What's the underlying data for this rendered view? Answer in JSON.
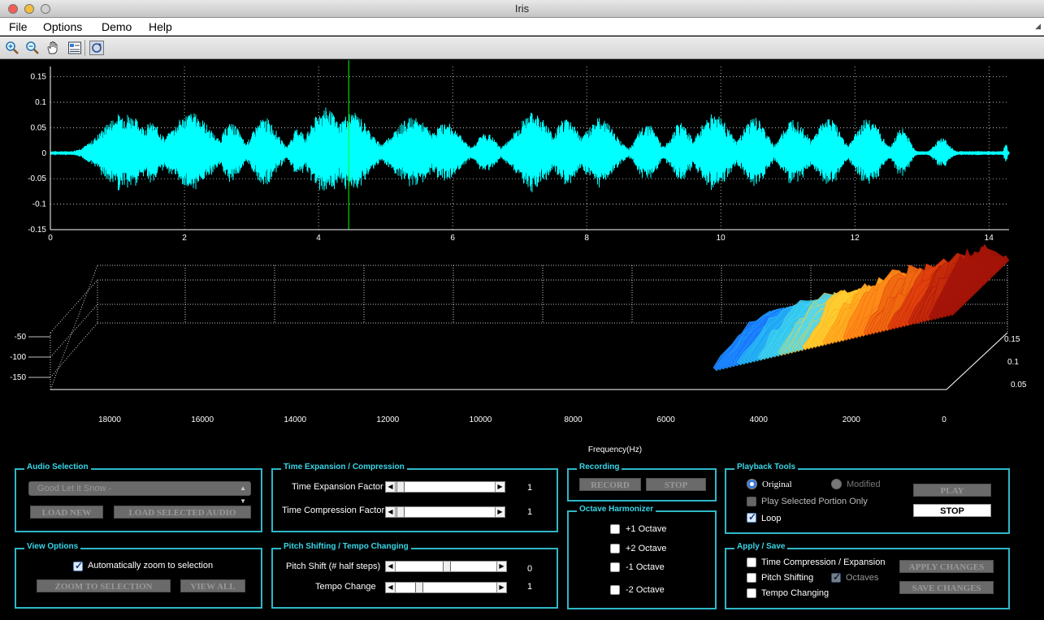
{
  "window": {
    "title": "Iris"
  },
  "menu": [
    {
      "label": "File"
    },
    {
      "label": "Options"
    },
    {
      "label": "Demo"
    },
    {
      "label": "Help"
    }
  ],
  "toolbar": [
    {
      "icon": "zoom-in-icon"
    },
    {
      "icon": "zoom-out-icon"
    },
    {
      "icon": "pan-hand-icon"
    },
    {
      "icon": "data-cursor-icon"
    },
    {
      "icon": "rotate-3d-icon"
    }
  ],
  "waveform": {
    "color": "#00ffff",
    "cursor_color": "#00ff00",
    "cursor_at": 4.45,
    "xlim": [
      0,
      14.3
    ],
    "ylim": [
      -0.15,
      0.17
    ],
    "x_ticks": [
      "0",
      "2",
      "4",
      "6",
      "8",
      "10",
      "12",
      "14"
    ],
    "y_ticks": [
      "0.15",
      "0.1",
      "0.05",
      "0",
      "-0.05",
      "-0.1",
      "-0.15"
    ]
  },
  "spectrogram": {
    "z_ticks": [
      "-50",
      "-100",
      "-150"
    ],
    "freq_ticks": [
      "18000",
      "16000",
      "14000",
      "12000",
      "10000",
      "8000",
      "6000",
      "4000",
      "2000",
      "0"
    ],
    "time_ticks": [
      "0.15",
      "0.1",
      "0.05"
    ],
    "xlabel": "Frequency(Hz)"
  },
  "audio_selection": {
    "title": "Audio Selection",
    "dropdown_value": "Good Let it Snow -",
    "load_new": "LOAD NEW",
    "load_selected": "LOAD SELECTED AUDIO"
  },
  "view_options": {
    "title": "View Options",
    "auto_zoom_label": "Automatically zoom to selection",
    "zoom_button": "ZOOM TO SELECTION",
    "view_all_button": "VIEW ALL"
  },
  "time_panel": {
    "title": "Time Expansion / Compression",
    "expansion_label": "Time Expansion Factor",
    "expansion_value": "1",
    "compression_label": "Time Compression Factor",
    "compression_value": "1"
  },
  "pitch_panel": {
    "title": "Pitch Shifting / Tempo Changing",
    "pitch_label": "Pitch Shift (# half steps)",
    "pitch_value": "0",
    "tempo_label": "Tempo Change",
    "tempo_value": "1"
  },
  "recording": {
    "title": "Recording",
    "record": "RECORD",
    "stop": "STOP"
  },
  "harmonizer": {
    "title": "Octave Harmonizer",
    "options": [
      "+1 Octave",
      "+2 Octave",
      "-1 Octave",
      "-2 Octave"
    ]
  },
  "playback": {
    "title": "Playback Tools",
    "original": "Original",
    "modified": "Modified",
    "selected_only": "Play Selected Portion Only",
    "loop": "Loop",
    "play": "PLAY",
    "stop": "STOP"
  },
  "apply_save": {
    "title": "Apply / Save",
    "time_comp": "Time Compression / Expansion",
    "pitch": "Pitch Shifting",
    "octaves": "Octaves",
    "tempo": "Tempo Changing",
    "apply": "APPLY CHANGES",
    "save": "SAVE CHANGES"
  }
}
